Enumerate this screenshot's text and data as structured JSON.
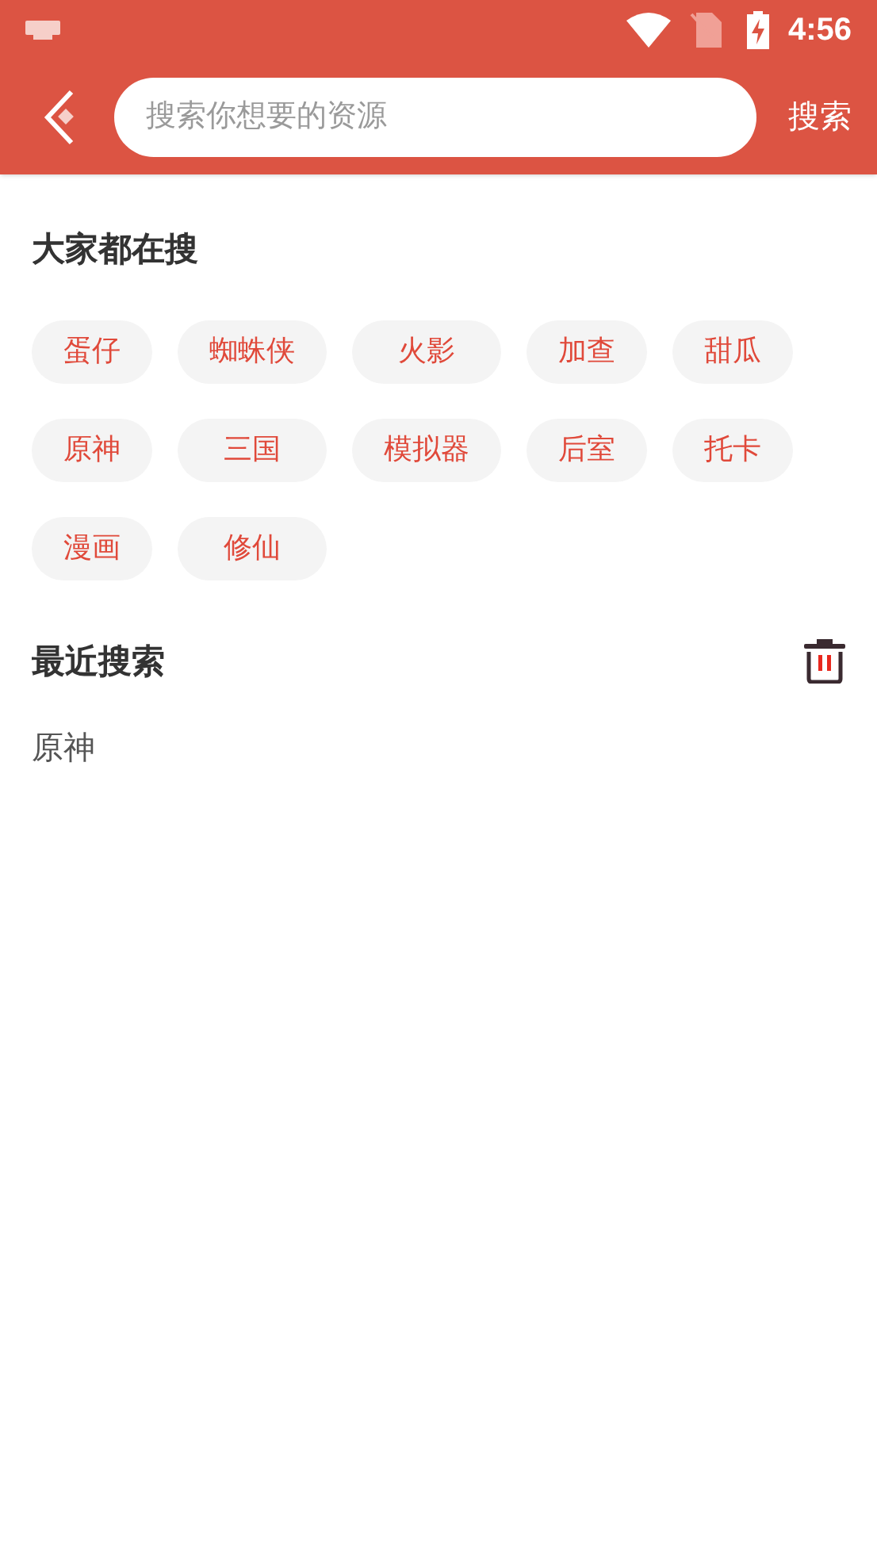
{
  "status_bar": {
    "time": "4:56"
  },
  "search_bar": {
    "placeholder": "搜索你想要的资源",
    "button": "搜索"
  },
  "popular": {
    "title": "大家都在搜",
    "tags": [
      "蛋仔",
      "蜘蛛侠",
      "火影",
      "加查",
      "甜瓜",
      "原神",
      "三国",
      "模拟器",
      "后室",
      "托卡",
      "漫画",
      "修仙"
    ]
  },
  "recent": {
    "title": "最近搜索",
    "items": [
      "原神"
    ]
  }
}
